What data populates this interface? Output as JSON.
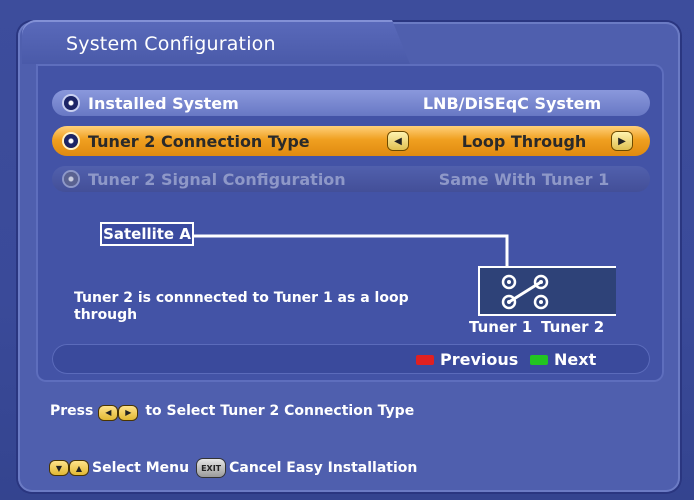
{
  "title": "System Configuration",
  "rows": [
    {
      "label": "Installed System",
      "value": "LNB/DiSEqC System"
    },
    {
      "label": "Tuner 2 Connection Type",
      "value": "Loop Through"
    },
    {
      "label": "Tuner 2 Signal Configuration",
      "value": "Same With Tuner 1"
    }
  ],
  "diagram": {
    "satellite": "Satellite A",
    "description": "Tuner 2 is connnected to Tuner 1 as a loop through",
    "tuner1": "Tuner 1",
    "tuner2": "Tuner 2"
  },
  "nav": {
    "previous": "Previous",
    "next": "Next",
    "previous_color": "#e02020",
    "next_color": "#22c422"
  },
  "help": {
    "press": "Press",
    "select_connection": "to Select Tuner 2 Connection Type",
    "select_menu": "Select Menu",
    "exit_key": "EXIT",
    "cancel": "Cancel Easy Installation"
  },
  "colors": {
    "highlight": "#f0a020",
    "background": "#3d4d9c"
  },
  "icons": {
    "left_arrow": "left-arrow-icon",
    "right_arrow": "right-arrow-icon",
    "up_down": "up-down-arrow-icon",
    "exit": "exit-key-icon"
  }
}
